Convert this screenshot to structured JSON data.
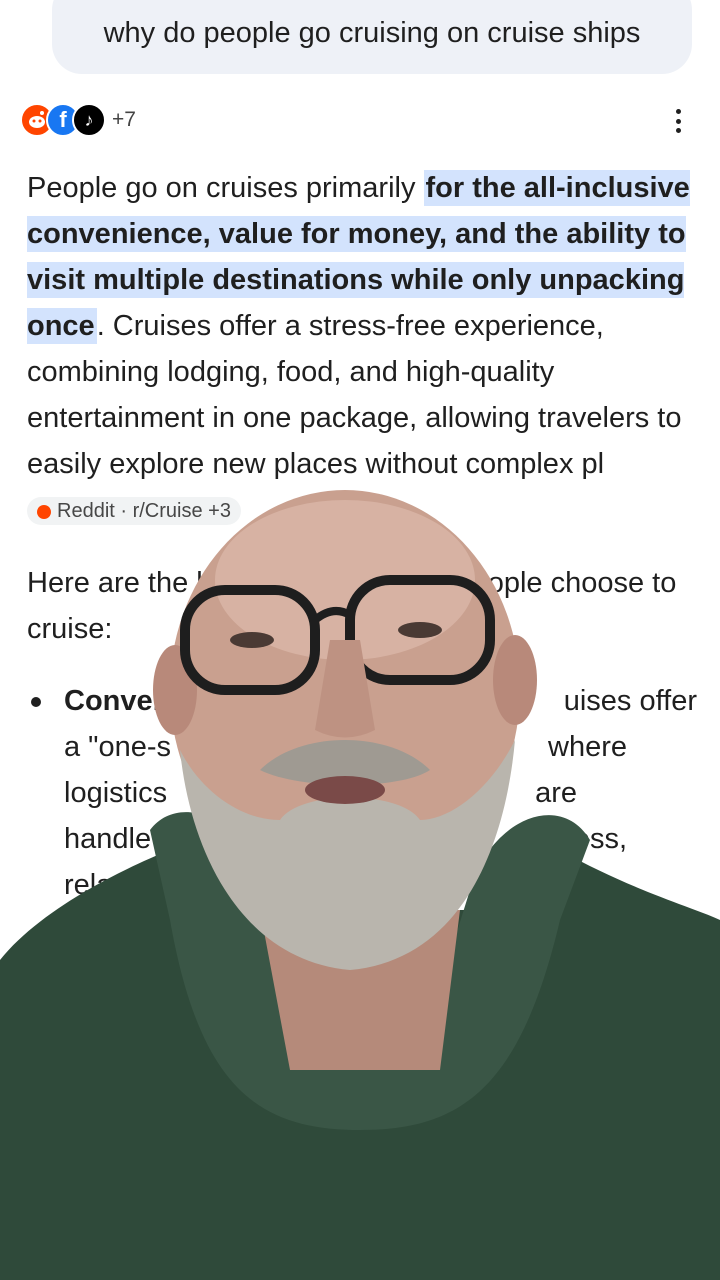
{
  "query": "why do people go cruising on cruise ships",
  "sources": {
    "icons": [
      "reddit-icon",
      "facebook-icon",
      "tiktok-icon"
    ],
    "more_count": "+7"
  },
  "answer": {
    "lead": "People go on cruises primarily ",
    "highlight": "for the all-inclusive convenience, value for money, and the ability to visit multiple destinations while only unpacking once",
    "rest": ". Cruises offer a stress-free experience, combining lodging, food, and high-quality entertainment in one package, allowing travelers to easily explore new places without complex pl",
    "citation": "Reddit · r/Cruise +3"
  },
  "intro": {
    "start": "Here are the l",
    "end": "ople choose to cruise:"
  },
  "bullets": [
    {
      "title": "Conven",
      "text_a": "a \"one-s",
      "text_b": "logistics",
      "text_c": "handle",
      "text_d": "rela",
      "right_a": "uises offer",
      "right_b": "where",
      "right_c": "are",
      "right_d": "-stress,"
    }
  ],
  "colors": {
    "highlight": "#d3e3fd",
    "query_bg": "#eef1f7",
    "hoodie": "#2f4a3a"
  }
}
